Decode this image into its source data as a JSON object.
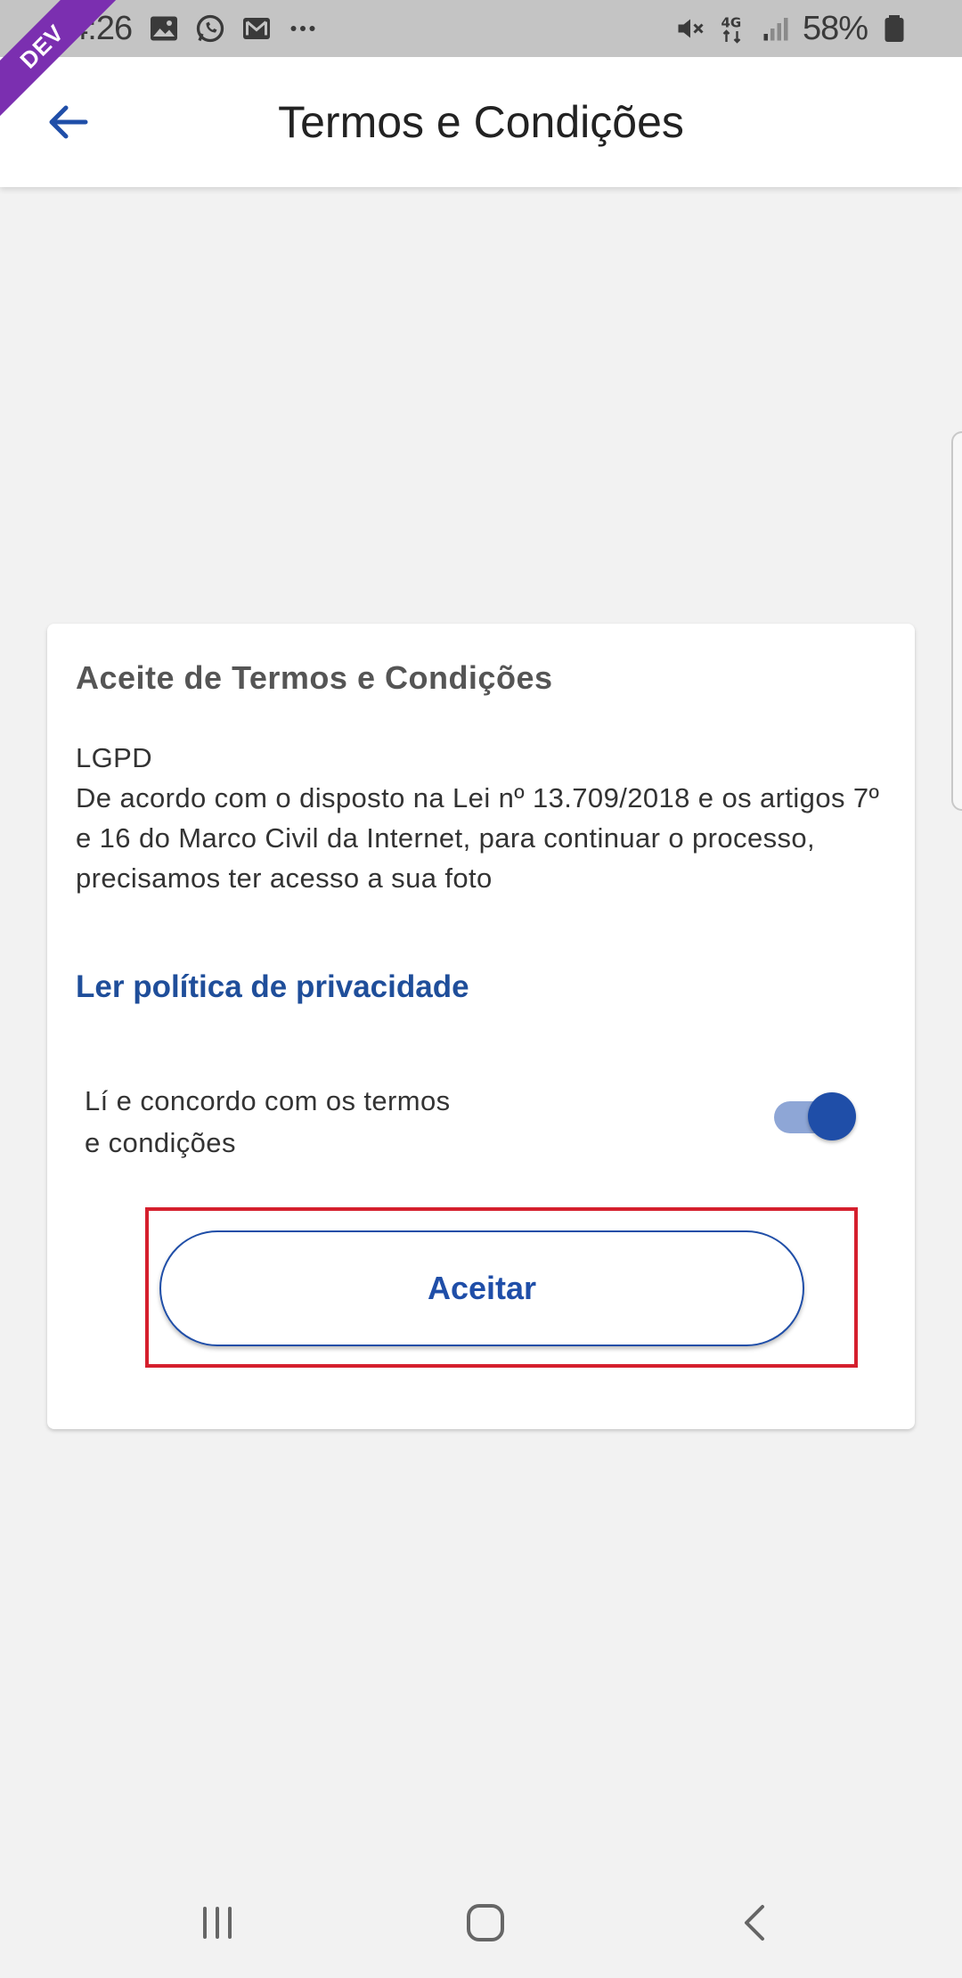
{
  "status_bar": {
    "time": "14:26",
    "battery_percent": "58%",
    "left_icons": [
      "image-icon",
      "whatsapp-icon",
      "gmail-icon",
      "more-dots-icon"
    ],
    "right_icons": [
      "mute-icon",
      "4g-icon",
      "signal-icon",
      "battery-icon"
    ]
  },
  "ribbon": {
    "label": "DEV",
    "color": "#7b2fb0"
  },
  "app_bar": {
    "title": "Termos e Condições",
    "back_icon": "arrow-left-icon",
    "accent": "#1f4ea8"
  },
  "card": {
    "title": "Aceite de Termos e Condições",
    "body_heading": "LGPD",
    "body_text": "De acordo com o disposto na Lei nº 13.709/2018 e os artigos 7º e 16 do Marco Civil da Internet, para continuar o processo, precisamos ter acesso a sua foto",
    "privacy_link": "Ler política de privacidade",
    "agree_label": "Lí e concordo com os termos e condições",
    "toggle_on": true,
    "accept_button": "Aceitar",
    "highlight_color": "#d51f2d"
  },
  "nav_bar": {
    "icons": [
      "recent-apps-icon",
      "home-icon",
      "back-icon"
    ]
  }
}
